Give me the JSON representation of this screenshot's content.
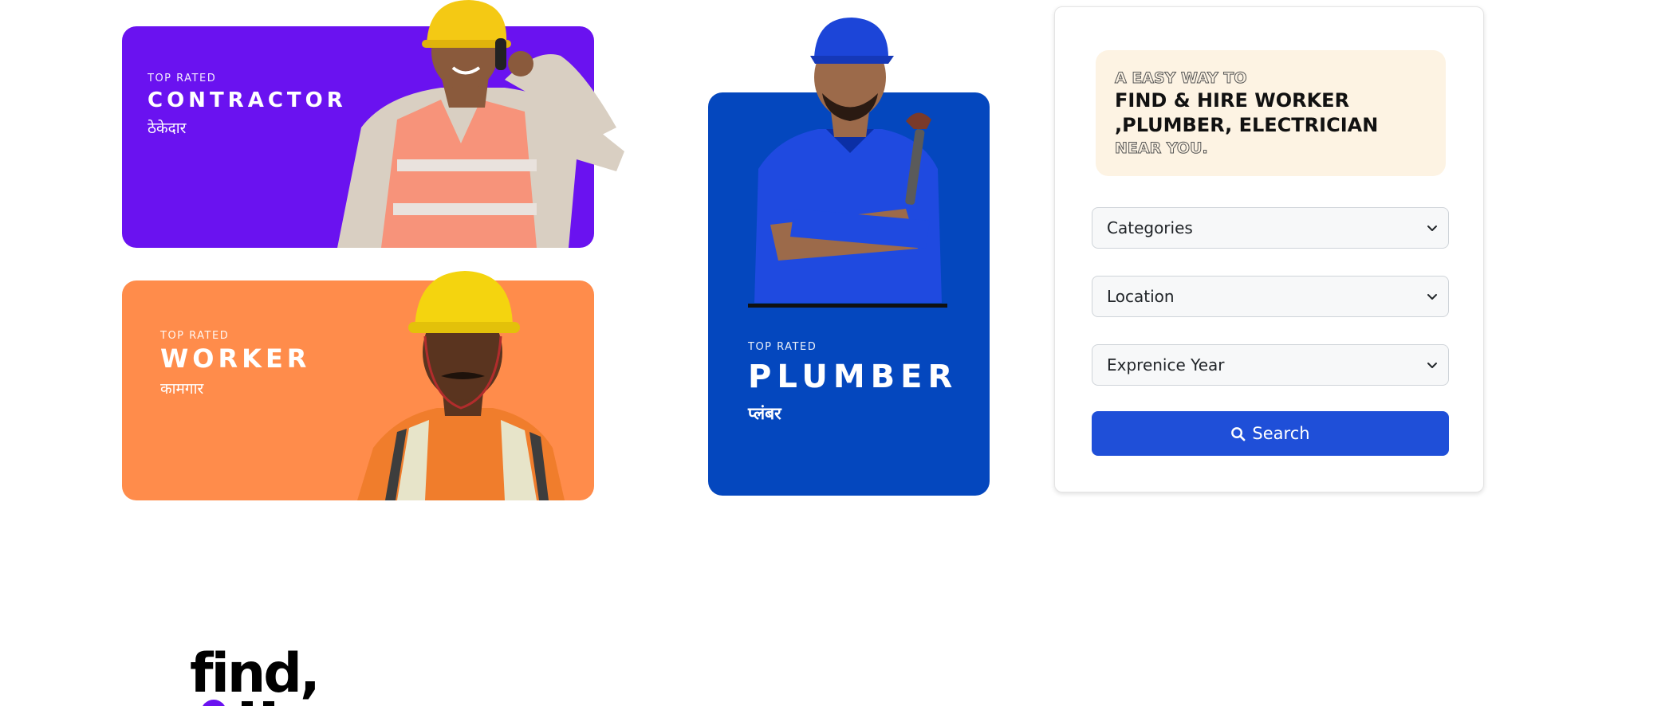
{
  "banners": {
    "contractor": {
      "eyebrow": "TOP RATED",
      "title": "CONTRACTOR",
      "local": "ठेकेदार",
      "color": "#6a12f0"
    },
    "worker": {
      "eyebrow": "TOP RATED",
      "title": "WORKER",
      "local": "कामगार",
      "color": "#ff8c4b"
    },
    "plumber": {
      "eyebrow": "TOP RATED",
      "title": "PLUMBER",
      "local": "प्लंबर",
      "color": "#0447be"
    }
  },
  "search_panel": {
    "tagline_top": "A EASY WAY TO",
    "tagline_main": "FIND & HIRE WORKER ,PLUMBER, ELECTRICIAN",
    "tagline_bottom": "NEAR YOU.",
    "tagline_bg": "#fdf3e3",
    "selects": [
      {
        "value": "Categories"
      },
      {
        "value": "Location"
      },
      {
        "value": "Exprenice Year"
      }
    ],
    "search_label": "Search",
    "accent": "#1f4fd8"
  },
  "footer_logo": {
    "text": "find,"
  }
}
